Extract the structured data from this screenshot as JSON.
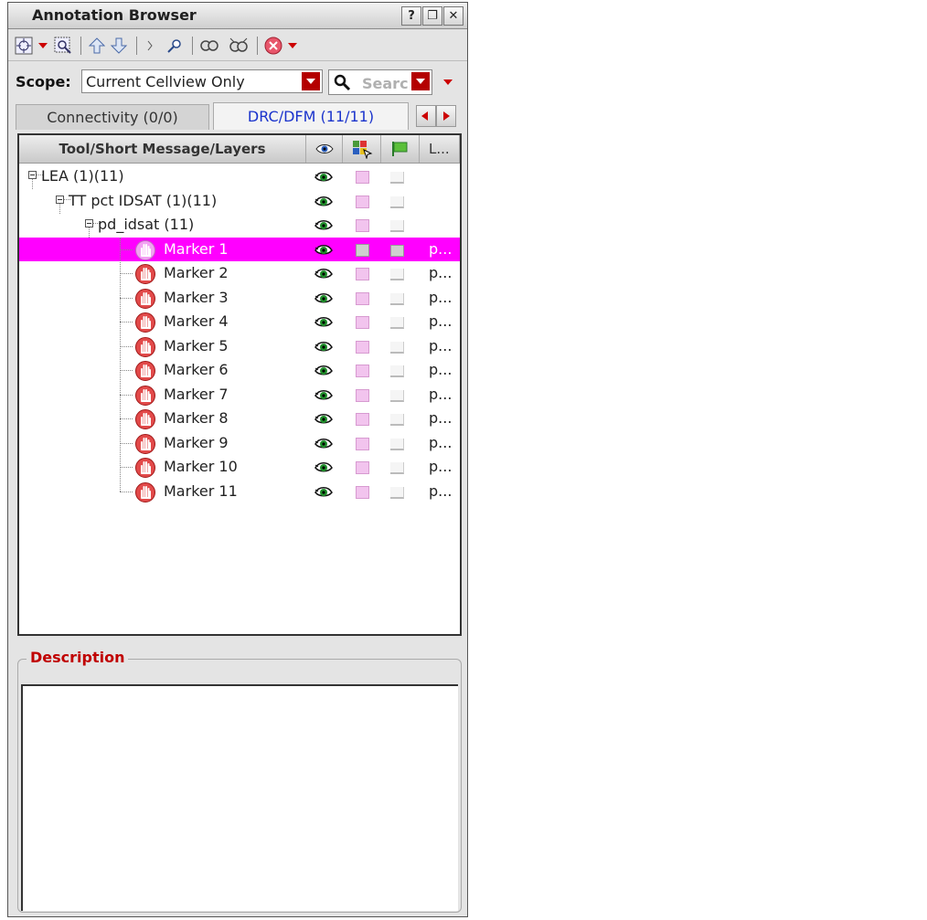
{
  "window": {
    "title": "Annotation Browser",
    "buttons": [
      "?",
      "❐",
      "✕"
    ]
  },
  "toolbar": {
    "icons": [
      "zoom-fit-icon",
      "zoom-select-icon",
      "up-arrow-icon",
      "down-arrow-icon",
      "cursor-icon",
      "search-icon",
      "link-icon",
      "unlink-icon",
      "stop-icon"
    ]
  },
  "scope": {
    "label": "Scope:",
    "value": "Current Cellview Only",
    "search_placeholder": "Searc"
  },
  "tabs": [
    {
      "label": "Connectivity (0/0)",
      "active": false
    },
    {
      "label": "DRC/DFM (11/11)",
      "active": true
    }
  ],
  "tree": {
    "columns": {
      "name": "Tool/Short Message/Layers",
      "layers": "L..."
    },
    "rows": [
      {
        "label": "LEA (1)(11)",
        "level": 0,
        "expandable": true,
        "layer": ""
      },
      {
        "label": "TT pct IDSAT (1)(11)",
        "level": 1,
        "expandable": true,
        "layer": ""
      },
      {
        "label": "pd_idsat (11)",
        "level": 2,
        "expandable": true,
        "layer": ""
      },
      {
        "label": "Marker 1",
        "level": 3,
        "marker": true,
        "selected": true,
        "layer": "p..."
      },
      {
        "label": "Marker 2",
        "level": 3,
        "marker": true,
        "layer": "p..."
      },
      {
        "label": "Marker 3",
        "level": 3,
        "marker": true,
        "layer": "p..."
      },
      {
        "label": "Marker 4",
        "level": 3,
        "marker": true,
        "layer": "p..."
      },
      {
        "label": "Marker 5",
        "level": 3,
        "marker": true,
        "layer": "p..."
      },
      {
        "label": "Marker 6",
        "level": 3,
        "marker": true,
        "layer": "p..."
      },
      {
        "label": "Marker 7",
        "level": 3,
        "marker": true,
        "layer": "p..."
      },
      {
        "label": "Marker 8",
        "level": 3,
        "marker": true,
        "layer": "p..."
      },
      {
        "label": "Marker 9",
        "level": 3,
        "marker": true,
        "layer": "p..."
      },
      {
        "label": "Marker 10",
        "level": 3,
        "marker": true,
        "layer": "p..."
      },
      {
        "label": "Marker 11",
        "level": 3,
        "marker": true,
        "layer": "p..."
      }
    ]
  },
  "description": {
    "title": "Description",
    "text": ""
  },
  "colors": {
    "selection": "#ff00ff",
    "accent_red": "#c00000",
    "active_tab_text": "#1a33cc"
  }
}
